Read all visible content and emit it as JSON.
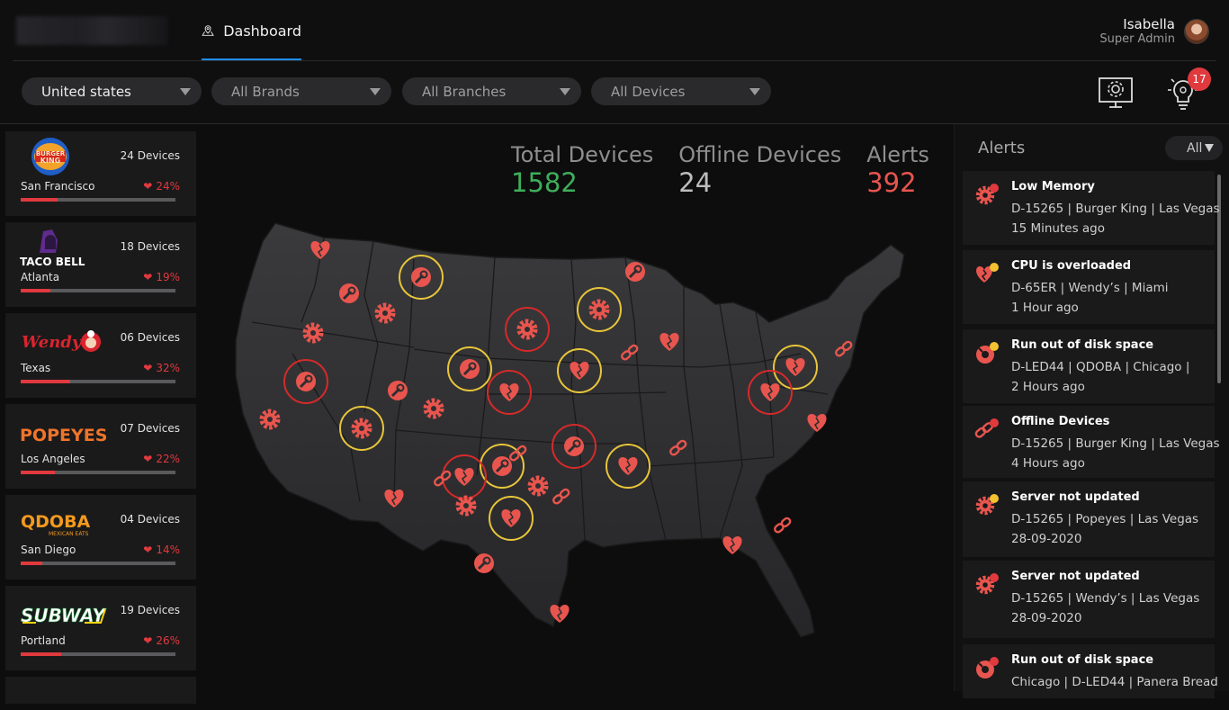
{
  "header": {
    "tab": "Dashboard",
    "user_name": "Isabella",
    "user_role": "Super Admin"
  },
  "filters": {
    "country": "United states",
    "brands": "All Brands",
    "branches": "All Branches",
    "devices": "All Devices",
    "notification_count": "17"
  },
  "brands": [
    {
      "name": "Burger King",
      "devices": "24 Devices",
      "city": "San Francisco",
      "pct": "24%",
      "fill": 0.24
    },
    {
      "name": "TACO BELL",
      "devices": "18 Devices",
      "city": "Atlanta",
      "pct": "19%",
      "fill": 0.19
    },
    {
      "name": "Wendy's",
      "devices": "06 Devices",
      "city": "Texas",
      "pct": "32%",
      "fill": 0.32
    },
    {
      "name": "POPEYES",
      "devices": "07 Devices",
      "city": "Los Angeles",
      "pct": "22%",
      "fill": 0.22
    },
    {
      "name": "QDOBA",
      "tagline": "MEXICAN EATS",
      "devices": "04 Devices",
      "city": "San Diego",
      "pct": "14%",
      "fill": 0.14
    },
    {
      "name": "SUBWAY",
      "devices": "19 Devices",
      "city": "Portland",
      "pct": "26%",
      "fill": 0.26
    }
  ],
  "stats": {
    "total_label": "Total Devices",
    "total_value": "1582",
    "total_color": "#3fae5a",
    "offline_label": "Offline Devices",
    "offline_value": "24",
    "offline_color": "#bdbdbd",
    "alerts_label": "Alerts",
    "alerts_value": "392",
    "alerts_color": "#e8554e"
  },
  "alerts": {
    "title": "Alerts",
    "filter": "All",
    "items": [
      {
        "title": "Low Memory",
        "line2": "D-15265 | Burger King | Las Vegas",
        "line3": "15 Minutes ago",
        "icon": "gear-icon",
        "dot": "#e0393e"
      },
      {
        "title": "CPU is overloaded",
        "line2": "D-65ER | Wendy’s  | Miami",
        "line3": "1 Hour ago",
        "icon": "heart-broken-icon",
        "dot": "#f2c230"
      },
      {
        "title": "Run out of disk space",
        "line2": "D-LED44 | QDOBA | Chicago |",
        "line3": "2 Hours ago",
        "icon": "disk-icon",
        "dot": "#f2c230"
      },
      {
        "title": "Offline Devices",
        "line2": "D-15265 | Burger King | Las Vegas",
        "line3": "4 Hours ago",
        "icon": "link-icon",
        "dot": "#e0393e"
      },
      {
        "title": "Server not updated",
        "line2": "D-15265 | Popeyes | Las Vegas",
        "line3": "28-09-2020",
        "icon": "gear-icon",
        "dot": "#f2c230"
      },
      {
        "title": "Server not updated",
        "line2": "D-15265 | Wendy’s | Las Vegas",
        "line3": "28-09-2020",
        "icon": "gear-icon",
        "dot": "#e0393e"
      },
      {
        "title": "Run out of disk space",
        "line2": "Chicago | D-LED44 | Panera Bread",
        "line3": "",
        "icon": "disk-icon",
        "dot": "#e0393e"
      }
    ]
  },
  "colors": {
    "accent": "#1e8fe8",
    "danger": "#e0393e",
    "warning": "#e8c53a",
    "marker": "#e8554e"
  }
}
